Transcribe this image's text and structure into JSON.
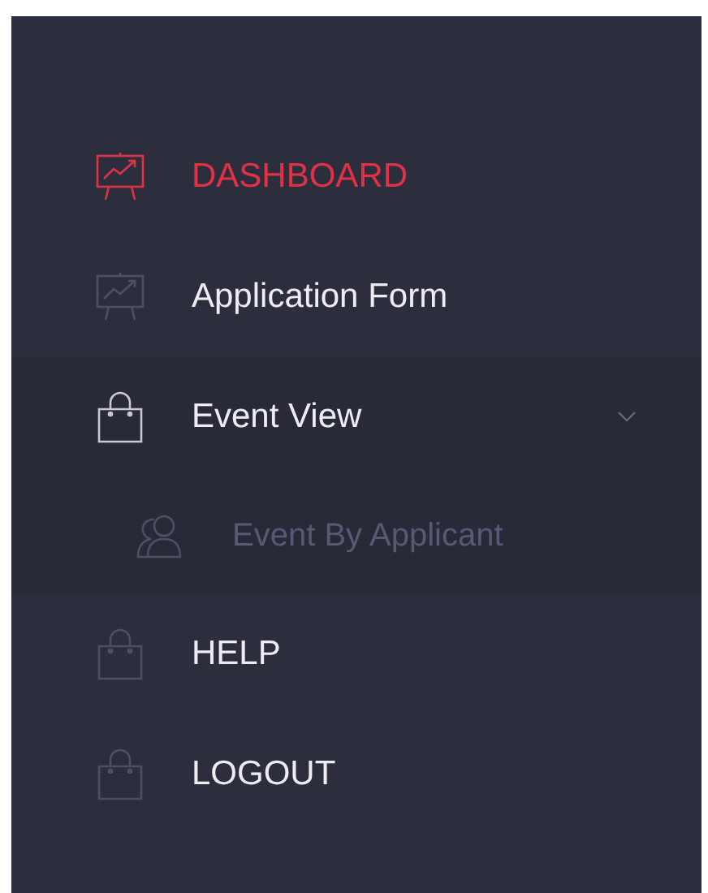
{
  "menu": [
    {
      "label": "DASHBOARD",
      "selected": true
    },
    {
      "label": "Application Form",
      "selected": false
    },
    {
      "label": "Event View",
      "selected": false,
      "expanded": true,
      "children": [
        {
          "label": "Event By Applicant",
          "selected": false
        }
      ]
    },
    {
      "label": "HELP",
      "selected": false
    },
    {
      "label": "LOGOUT",
      "selected": false
    }
  ]
}
